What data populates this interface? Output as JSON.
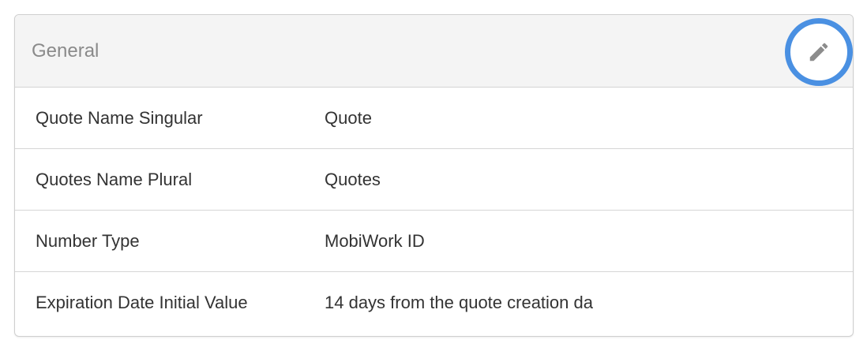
{
  "panel": {
    "title": "General",
    "edit_icon": "pencil-icon",
    "accent_color": "#4a90e2",
    "rows": [
      {
        "label": "Quote Name Singular",
        "value": "Quote"
      },
      {
        "label": "Quotes Name Plural",
        "value": "Quotes"
      },
      {
        "label": "Number Type",
        "value": "MobiWork ID"
      },
      {
        "label": "Expiration Date Initial Value",
        "value": "14 days from the quote creation da"
      }
    ]
  }
}
